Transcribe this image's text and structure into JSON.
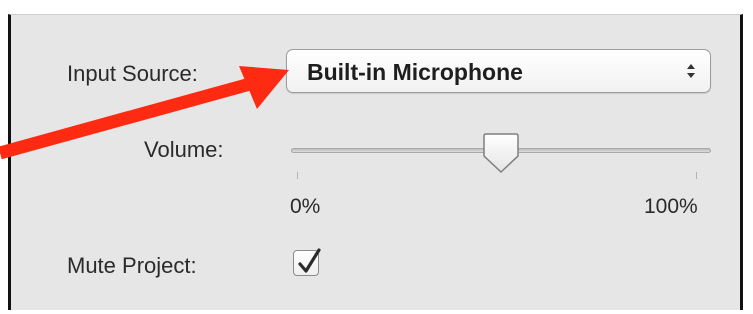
{
  "form": {
    "input_source_label": "Input Source:",
    "input_source_value": "Built-in Microphone",
    "volume_label": "Volume:",
    "volume_level_percent": 50,
    "volume_min_label": "0%",
    "volume_max_label": "100%",
    "mute_label": "Mute Project:",
    "mute_checked": true
  },
  "annotation": {
    "arrow_color": "#ff2a12"
  },
  "icons": {
    "popup_stepper": "up-down-chevrons-icon",
    "checkbox_mark": "checkmark-icon"
  }
}
